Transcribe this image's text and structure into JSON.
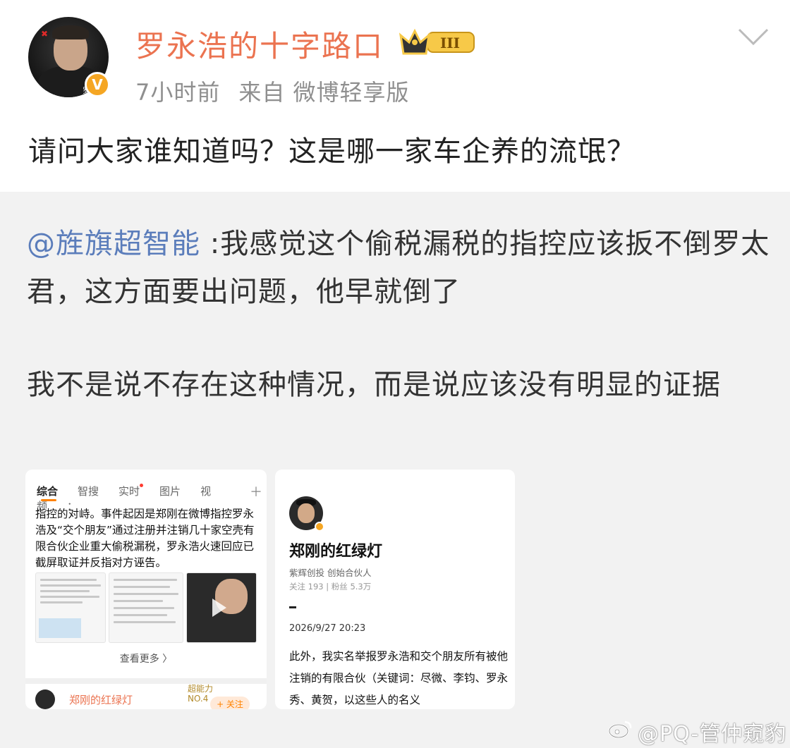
{
  "post": {
    "author": "罗永浩的十字路口",
    "level_badge": "III",
    "time": "7小时前",
    "source": "来自 微博轻享版",
    "text": "请问大家谁知道吗？这是哪一家车企养的流氓？",
    "avatar_caption": "罗永浩\n的十字路口"
  },
  "repost": {
    "mention": "@旌旗超智能",
    "line1": " :我感觉这个偷税漏税的指控应该扳不倒罗太君，这方面要出问题，他早就倒了",
    "para2": "我不是说不存在这种情况，而是说应该没有明显的证据"
  },
  "thumb1": {
    "tabs": [
      "综合",
      "智搜",
      "实时",
      "图片",
      "视频",
      "："
    ],
    "text": "指控的对峙。事件起因是郑刚在微博指控罗永浩及“交个朋友”通过注册并注销几十家空壳有限合伙企业重大偷税漏税，罗永浩火速回应已截屏取证并反指对方诬告。",
    "more": "查看更多 〉",
    "bottom_name": "郑刚的红绿灯",
    "bottom_badge": "超能力\nNO.4",
    "follow": "+ 关注"
  },
  "thumb2": {
    "name": "郑刚的红绿灯",
    "desc": "紫辉创投 创始合伙人",
    "stats": "关注 193 | 粉丝 5.3万",
    "date": "2026/9/27 20:23",
    "body": "此外，我实名举报罗永浩和交个朋友所有被他注销的有限合伙（关键词：尽微、李钧、罗永秀、黄贺，以这些人的名义"
  },
  "watermark": "@PQ-管仲窥豹",
  "colors": {
    "author": "#eb7350",
    "mention": "#5b7dbb",
    "meta": "#8f8f8f"
  }
}
